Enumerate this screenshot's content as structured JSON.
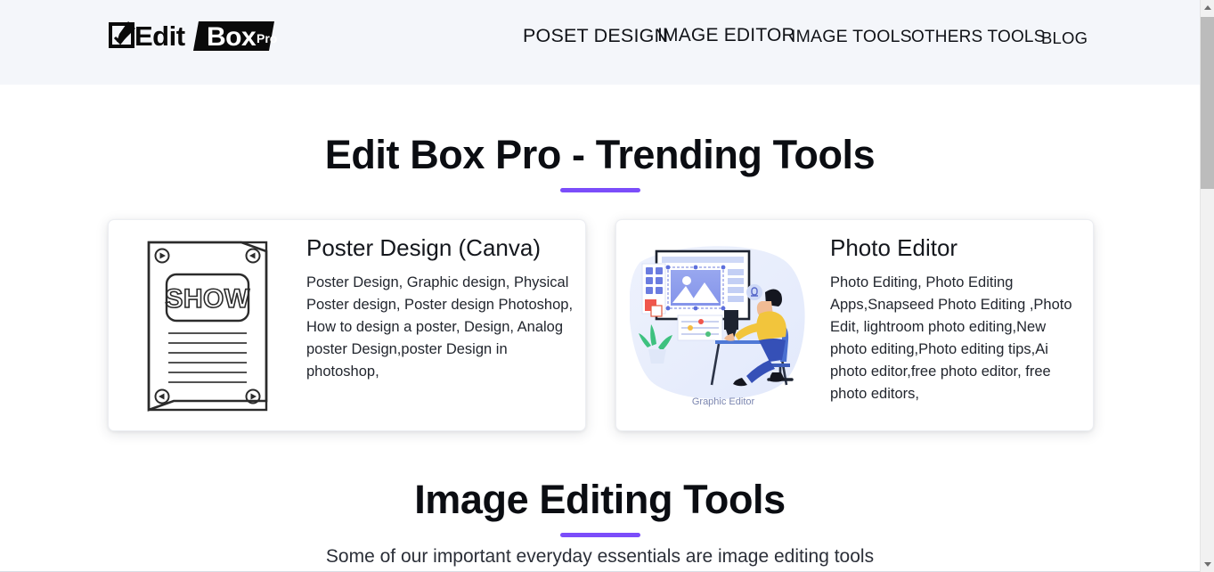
{
  "header": {
    "logo": {
      "icon": "edit-checkbox-pencil-icon",
      "text_primary": "Edit",
      "text_badge": "Box",
      "text_badge_small": "Pro"
    },
    "nav": {
      "items": [
        {
          "label": "POSET DESIGN",
          "name": "nav-link-poset-design"
        },
        {
          "label": "IMAGE EDITOR",
          "name": "nav-link-image-editor"
        },
        {
          "label": "IMAGE TOOLS",
          "name": "nav-link-image-tools"
        },
        {
          "label": "OTHERS TOOLS",
          "name": "nav-link-others-tools"
        },
        {
          "label": "BLOG",
          "name": "nav-link-blog"
        }
      ]
    },
    "background_color": "#f4f6fa"
  },
  "sections": {
    "trending": {
      "title": "Edit Box Pro - Trending Tools",
      "underline_color": "#7b4dfa"
    },
    "image_editing": {
      "title": "Image Editing Tools",
      "underline_color": "#7b4dfa",
      "subtitle": "Some of our important everyday essentials are image editing tools"
    }
  },
  "cards": [
    {
      "title": "Poster Design (Canva)",
      "description": "Poster Design, Graphic design, Physical Poster design, Poster design Photoshop, How to design a poster, Design, Analog poster Design,poster Design in photoshop,",
      "thumbnail": "poster-line-art-illustration",
      "thumbnail_label": "SHOW"
    },
    {
      "title": "Photo Editor",
      "description": "Photo Editing, Photo Editing Apps,Snapseed Photo Editing ,Photo Edit, lightroom photo editing,New photo editing,Photo editing tips,Ai photo editor,free photo editor, free photo editors,",
      "thumbnail": "graphic-editor-flat-illustration",
      "thumbnail_label": "Graphic Editor"
    }
  ],
  "scrollbar": {
    "up_icon": "scroll-up-arrow-icon",
    "down_icon": "scroll-down-arrow-icon",
    "thumb_name": "scrollbar-thumb"
  }
}
